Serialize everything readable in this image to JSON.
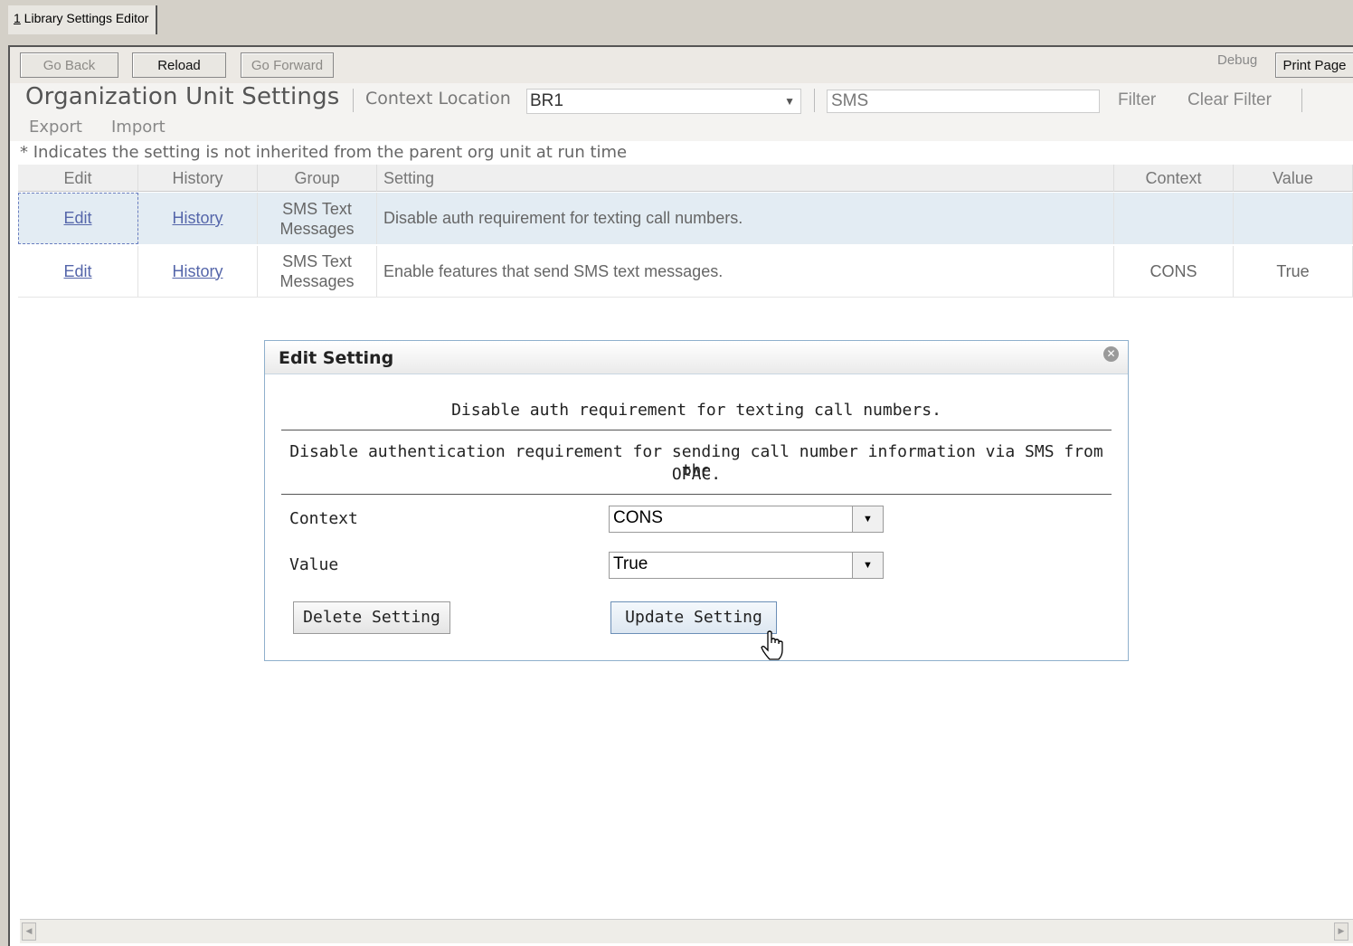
{
  "tab": {
    "number": "1",
    "label": " Library Settings Editor"
  },
  "toolbar": {
    "go_back": "Go Back",
    "reload": "Reload",
    "go_forward": "Go Forward",
    "debug": "Debug",
    "print_page": "Print Page"
  },
  "header": {
    "title": "Organization Unit Settings",
    "context_label": "Context Location",
    "context_value": "BR1",
    "filter_value": "SMS",
    "filter": "Filter",
    "clear_filter": "Clear Filter",
    "export": "Export",
    "import": "Import"
  },
  "note": "* Indicates the setting is not inherited from the parent org unit at run time",
  "table": {
    "headers": {
      "edit": "Edit",
      "history": "History",
      "group": "Group",
      "setting": "Setting",
      "context": "Context",
      "value": "Value"
    },
    "rows": [
      {
        "edit": "Edit",
        "history": "History",
        "group_line1": "SMS Text",
        "group_line2": "Messages",
        "setting": "Disable auth requirement for texting call numbers.",
        "context": "",
        "value": ""
      },
      {
        "edit": "Edit",
        "history": "History",
        "group_line1": "SMS Text",
        "group_line2": "Messages",
        "setting": "Enable features that send SMS text messages.",
        "context": "CONS",
        "value": "True"
      }
    ]
  },
  "dialog": {
    "title": "Edit Setting",
    "close_icon": "close-icon",
    "setting_name": "Disable auth requirement for texting call numbers.",
    "description_line1": "Disable authentication requirement for sending call number information via SMS from the",
    "description_line2": "OPAC.",
    "context_label": "Context",
    "context_value": "CONS",
    "value_label": "Value",
    "value_value": "True",
    "delete_button": "Delete Setting",
    "update_button": "Update Setting"
  }
}
